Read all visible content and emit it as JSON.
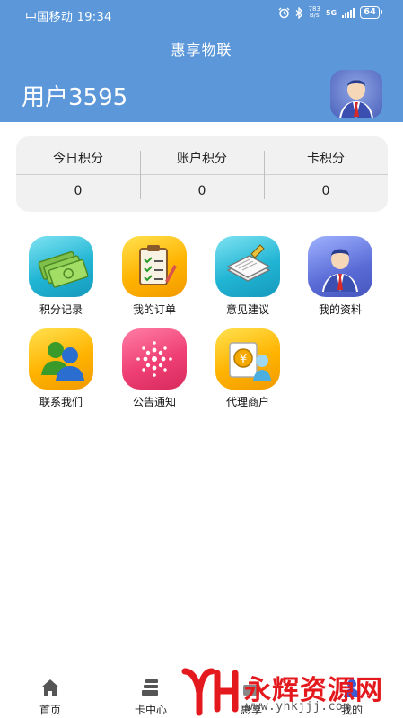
{
  "status": {
    "carrier_time": "中国移动 19:34",
    "net_speed_top": "783",
    "net_speed_unit": "B/s",
    "net_type": "5G",
    "battery": "64"
  },
  "header": {
    "title": "惠享物联",
    "username": "用户3595"
  },
  "points": {
    "today_label": "今日积分",
    "today_value": "0",
    "account_label": "账户积分",
    "account_value": "0",
    "card_label": "卡积分",
    "card_value": "0"
  },
  "menu": {
    "items": [
      {
        "label": "积分记录",
        "icon": "money-icon"
      },
      {
        "label": "我的订单",
        "icon": "clipboard-icon"
      },
      {
        "label": "意见建议",
        "icon": "documents-icon"
      },
      {
        "label": "我的资料",
        "icon": "user-icon"
      },
      {
        "label": "联系我们",
        "icon": "contacts-icon"
      },
      {
        "label": "公告通知",
        "icon": "dots-icon"
      },
      {
        "label": "代理商户",
        "icon": "merchant-icon"
      }
    ]
  },
  "nav": {
    "home": "首页",
    "card_center": "卡中心",
    "hui": "惠享",
    "mine": "我的"
  },
  "watermark": {
    "text": "永辉资源网",
    "url": "www.yhkjjj.com"
  },
  "colors": {
    "header_bg": "#5b97d9",
    "watermark_red": "#e4191e"
  }
}
